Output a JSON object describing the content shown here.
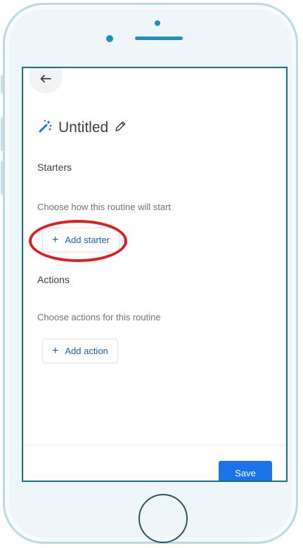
{
  "routine": {
    "title": "Untitled"
  },
  "starters": {
    "heading": "Starters",
    "description": "Choose how this routine will start",
    "button_label": "Add starter"
  },
  "actions": {
    "heading": "Actions",
    "description": "Choose actions for this routine",
    "button_label": "Add action"
  },
  "footer": {
    "save_label": "Save"
  },
  "icons": {
    "back": "back-arrow-icon",
    "title": "magic-wand-icon",
    "edit": "pencil-icon",
    "add": "plus-icon"
  },
  "colors": {
    "accent": "#1a73e8",
    "link": "#1a5fb8",
    "annotation": "#e11d1d",
    "device_frame": "#b9dbe8",
    "device_accent": "#1f8fbf"
  }
}
